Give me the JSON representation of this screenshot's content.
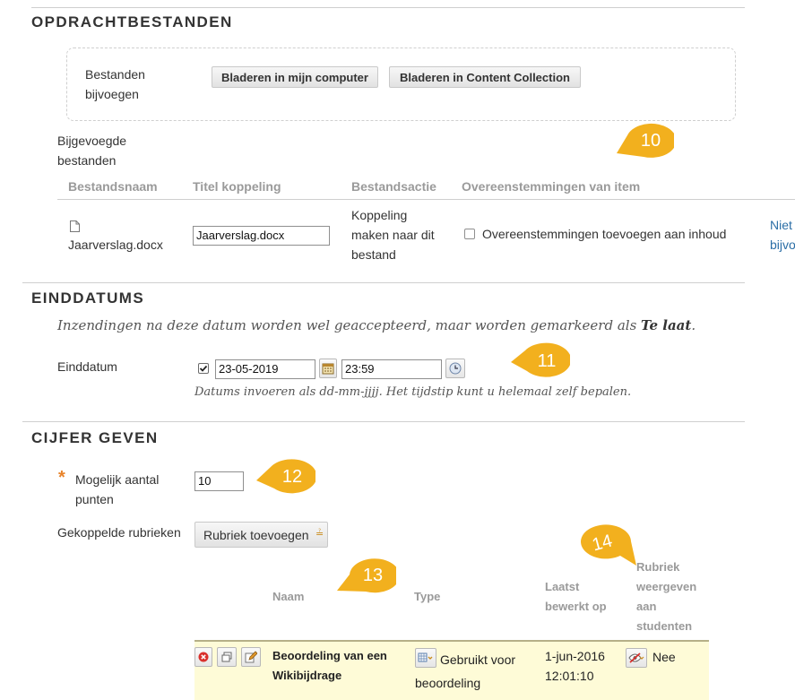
{
  "attachments": {
    "section_title": "OPDRACHTBESTANDEN",
    "attach_label": "Bestanden bijvoegen",
    "browse_computer_label": "Bladeren in mijn computer",
    "browse_collection_label": "Bladeren in Content Collection",
    "attached_label": "Bijgevoegde bestanden",
    "columns": [
      "Bestandsnaam",
      "Titel koppeling",
      "Bestandsactie",
      "Overeenstemmingen van item"
    ],
    "file": {
      "name": "Jaarverslag.docx",
      "link_title_value": "Jaarverslag.docx",
      "action": "Koppeling maken naar dit bestand",
      "alignment_label": "Overeenstemmingen toevoegen aan inhoud",
      "truncated_link": "Niet bijvo"
    }
  },
  "due_dates": {
    "section_title": "EINDDATUMS",
    "intro_prefix": "Inzendingen na deze datum worden wel geaccepteerd, maar worden gemarkeerd als ",
    "intro_bold": "Te laat",
    "intro_suffix": ".",
    "due_label": "Einddatum",
    "date_value": "23-05-2019",
    "time_value": "23:59",
    "hint": "Datums invoeren als dd-mm-jjjj. Het tijdstip kunt u helemaal zelf bepalen."
  },
  "grading": {
    "section_title": "CIJFER GEVEN",
    "required_mark": "*",
    "points_label": "Mogelijk aantal punten",
    "points_value": "10",
    "rubrics_label": "Gekoppelde rubrieken",
    "add_rubric_label": "Rubriek toevoegen",
    "rubric_columns": {
      "name": "Naam",
      "type": "Type",
      "last_edited": "Laatst bewerkt op",
      "show_to_students": "Rubriek weergeven aan studenten"
    },
    "rubric_row": {
      "name": "Beoordeling van een Wikibijdrage",
      "type": "Gebruikt voor beoordeling",
      "date": "1-jun-2016",
      "time": "12:01:10",
      "show": "Nee"
    }
  },
  "callouts": [
    "10",
    "11",
    "12",
    "13",
    "14"
  ],
  "colors": {
    "callout": "#f2b01e",
    "rubric_row_bg": "#fefbd7",
    "required": "#e8832a",
    "link": "#2b6ea6"
  }
}
